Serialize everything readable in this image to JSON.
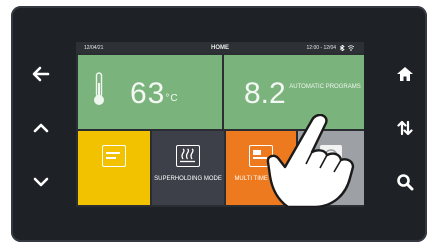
{
  "statusbar": {
    "left": "12/04/21",
    "title": "HOME",
    "right": "12:00 - 12/04"
  },
  "tiles": {
    "temperature": {
      "value": "63",
      "unit": "°C"
    },
    "auto": {
      "value": "8.2",
      "label": "AUTOMATIC PROGRAMS"
    },
    "a": {
      "label": ""
    },
    "b": {
      "label": "SUPERHOLDING MODE"
    },
    "c": {
      "label": "MULTI TIME MODE"
    },
    "d": {
      "label": ""
    }
  },
  "side_buttons": {
    "left": [
      "arrow-left-icon",
      "chevron-up-icon",
      "chevron-down-icon"
    ],
    "right": [
      "home-icon",
      "swap-arrows-icon",
      "search-icon"
    ]
  },
  "colors": {
    "green": "#7bb37c",
    "yellow": "#f2c200",
    "dark": "#3d4048",
    "orange": "#ee7a1f",
    "grey": "#9da1a6"
  }
}
